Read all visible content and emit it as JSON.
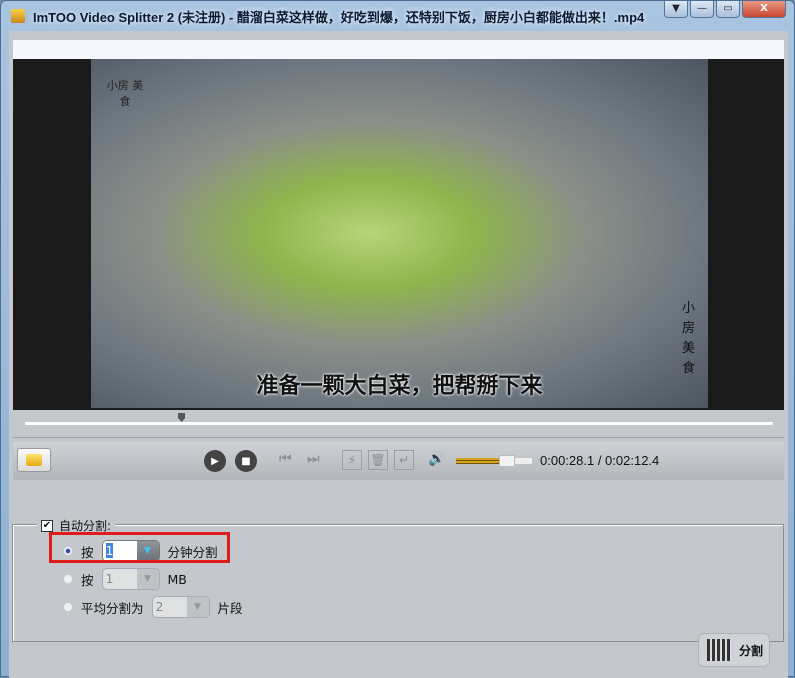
{
  "window": {
    "title": "ImTOO Video Splitter 2 (未注册) - 醋溜白菜这样做，好吃到爆，还特别下饭，厨房小白都能做出来！.mp4",
    "menu_glyph": "▼",
    "minimize_glyph": "—",
    "maximize_glyph": "▭",
    "close_glyph": "X"
  },
  "video": {
    "subtitle": "准备一颗大白菜，把帮掰下来",
    "logo_text": "小房 美食",
    "side_text": "小房美食"
  },
  "player": {
    "play": "▶",
    "stop": "■",
    "prev": "⏮",
    "next": "⏭",
    "split_mark": "⚡",
    "delete": "🗑",
    "enter": "↵",
    "volume": "🔊",
    "time": "0:00:28.1 / 0:02:12.4",
    "volume_level": 0.62,
    "seek_position": 0.21
  },
  "auto_split": {
    "label": "自动分割:",
    "checked": true,
    "options": [
      {
        "prefix": "按",
        "value": "1",
        "suffix": "分钟分割",
        "selected": true
      },
      {
        "prefix": "按",
        "value": "1",
        "suffix": "MB",
        "selected": false
      },
      {
        "prefix": "平均分割为",
        "value": "2",
        "suffix": "片段",
        "selected": false
      }
    ]
  },
  "split_button": "分割"
}
